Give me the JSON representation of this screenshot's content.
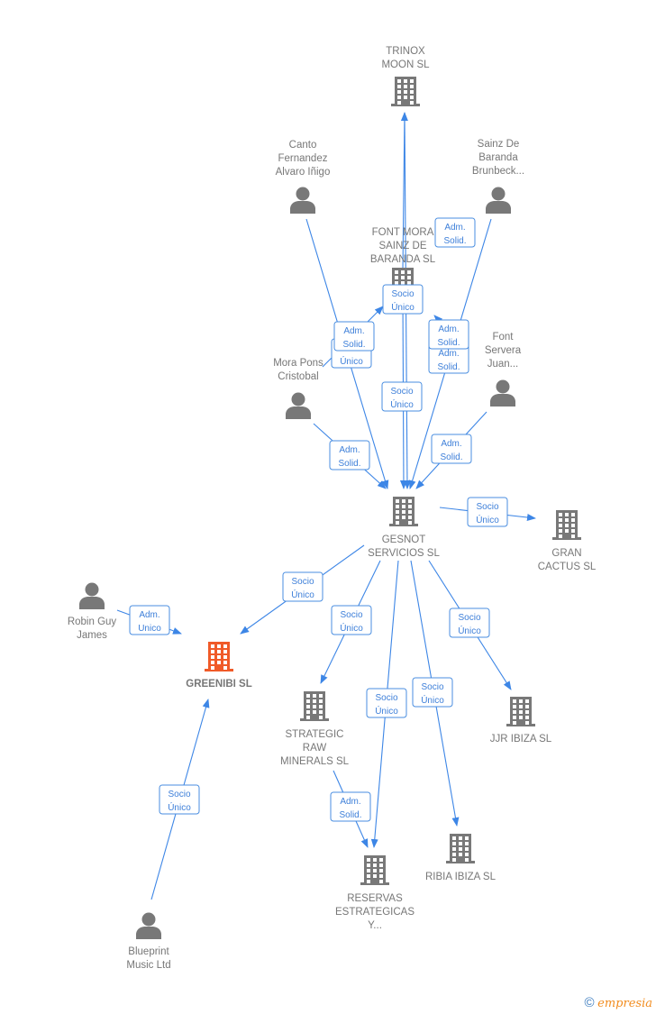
{
  "colors": {
    "edge": "#3d86e6",
    "node": "#787878",
    "highlight": "#f05a28",
    "label_text": "#3d7fd9"
  },
  "nodes": [
    {
      "id": "trinox",
      "type": "company",
      "lines": [
        "TRINOX",
        "MOON  SL"
      ]
    },
    {
      "id": "canto",
      "type": "person",
      "lines": [
        "Canto",
        "Fernandez",
        "Alvaro Iñigo"
      ]
    },
    {
      "id": "sainz",
      "type": "person",
      "lines": [
        "Sainz De",
        "Baranda",
        "Brunbeck..."
      ]
    },
    {
      "id": "fontmora",
      "type": "company",
      "lines": [
        "FONT MORA",
        "SAINZ DE",
        "BARANDA  SL"
      ]
    },
    {
      "id": "mora",
      "type": "person",
      "lines": [
        "Mora Pons",
        "Cristobal"
      ]
    },
    {
      "id": "fontservera",
      "type": "person",
      "lines": [
        "Font",
        "Servera",
        "Juan..."
      ]
    },
    {
      "id": "gesnot",
      "type": "company",
      "lines": [
        "GESNOT",
        "SERVICIOS  SL"
      ]
    },
    {
      "id": "gran",
      "type": "company",
      "lines": [
        "GRAN",
        "CACTUS  SL"
      ]
    },
    {
      "id": "robin",
      "type": "person",
      "lines": [
        "Robin Guy",
        "James"
      ]
    },
    {
      "id": "greenibi",
      "type": "company",
      "highlight": true,
      "lines": [
        "GREENIBI  SL"
      ]
    },
    {
      "id": "strategic",
      "type": "company",
      "lines": [
        "STRATEGIC",
        "RAW",
        "MINERALS  SL"
      ]
    },
    {
      "id": "jjr",
      "type": "company",
      "lines": [
        "JJR IBIZA  SL"
      ]
    },
    {
      "id": "ribia",
      "type": "company",
      "lines": [
        "RIBIA IBIZA  SL"
      ]
    },
    {
      "id": "reservas",
      "type": "company",
      "lines": [
        "RESERVAS",
        "ESTRATEGICAS",
        "Y..."
      ]
    },
    {
      "id": "blueprint",
      "type": "person",
      "lines": [
        "Blueprint",
        "Music Ltd"
      ]
    }
  ],
  "edges": [
    {
      "from": "fontmora",
      "to": "trinox",
      "label": [
        "Adm.",
        "Solid."
      ]
    },
    {
      "from": "mora",
      "to": "fontmora",
      "label": [
        "Socio",
        "Único"
      ]
    },
    {
      "from": "canto",
      "to": "gesnot",
      "label": [
        "Adm.",
        "Solid."
      ]
    },
    {
      "from": "sainz",
      "to": "gesnot",
      "label": [
        "Adm.",
        "Solid."
      ]
    },
    {
      "from": "sainz",
      "to": "fontmora",
      "label": [
        "Adm.",
        "Solid."
      ]
    },
    {
      "from": "fontmora",
      "to": "gesnot",
      "label": [
        "Socio",
        "Único"
      ]
    },
    {
      "from": "trinox",
      "to": "gesnot",
      "label": [
        "Socio",
        "Único"
      ]
    },
    {
      "from": "mora",
      "to": "gesnot",
      "label": [
        "Adm.",
        "Solid."
      ]
    },
    {
      "from": "fontservera",
      "to": "gesnot",
      "label": [
        "Adm.",
        "Solid."
      ]
    },
    {
      "from": "gesnot",
      "to": "gran",
      "label": [
        "Socio",
        "Único"
      ]
    },
    {
      "from": "gesnot",
      "to": "greenibi",
      "label": [
        "Socio",
        "Único"
      ]
    },
    {
      "from": "robin",
      "to": "greenibi",
      "label": [
        "Adm.",
        "Unico"
      ]
    },
    {
      "from": "gesnot",
      "to": "strategic",
      "label": [
        "Socio",
        "Único"
      ]
    },
    {
      "from": "gesnot",
      "to": "reservas",
      "label": [
        "Socio",
        "Único"
      ]
    },
    {
      "from": "gesnot",
      "to": "ribia",
      "label": [
        "Socio",
        "Único"
      ]
    },
    {
      "from": "gesnot",
      "to": "jjr",
      "label": [
        "Socio",
        "Único"
      ]
    },
    {
      "from": "strategic",
      "to": "reservas",
      "label": [
        "Adm.",
        "Solid."
      ]
    },
    {
      "from": "blueprint",
      "to": "greenibi",
      "label": [
        "Socio",
        "Único"
      ]
    }
  ],
  "footer": {
    "copyright": "©",
    "brand_initial": "e",
    "brand_rest": "mpresia"
  }
}
